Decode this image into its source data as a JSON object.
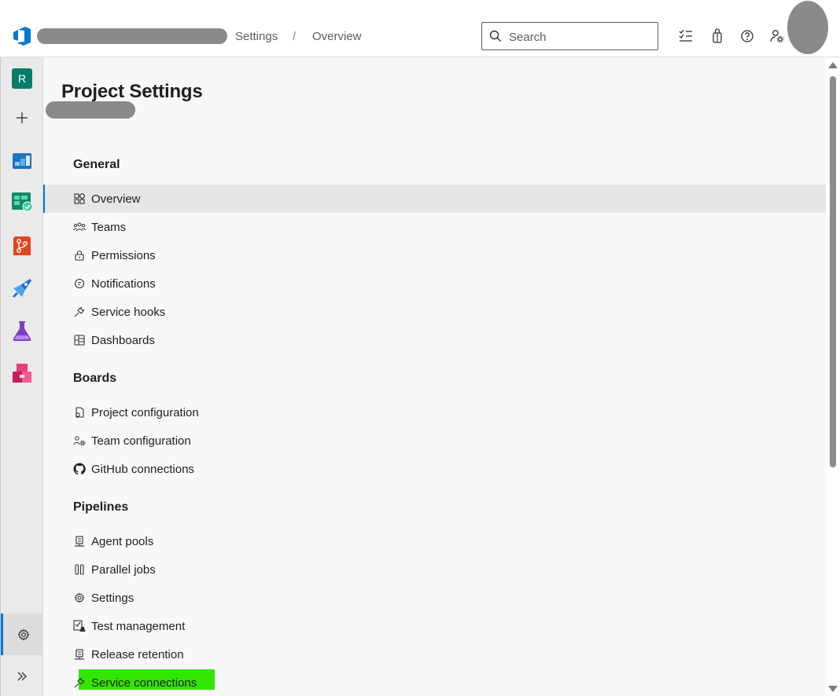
{
  "header": {
    "breadcrumb": [
      "Settings",
      "Overview"
    ],
    "separator": "/",
    "search_placeholder": "Search"
  },
  "rail": {
    "project_initial": "R"
  },
  "page": {
    "title": "Project Settings"
  },
  "sections": [
    {
      "title": "General",
      "items": [
        {
          "label": "Overview",
          "icon": "overview-icon",
          "selected": true
        },
        {
          "label": "Teams",
          "icon": "teams-icon"
        },
        {
          "label": "Permissions",
          "icon": "lock-icon"
        },
        {
          "label": "Notifications",
          "icon": "notification-icon"
        },
        {
          "label": "Service hooks",
          "icon": "plug-icon"
        },
        {
          "label": "Dashboards",
          "icon": "dashboard-icon"
        }
      ]
    },
    {
      "title": "Boards",
      "items": [
        {
          "label": "Project configuration",
          "icon": "config-icon"
        },
        {
          "label": "Team configuration",
          "icon": "team-config-icon"
        },
        {
          "label": "GitHub connections",
          "icon": "github-icon"
        }
      ]
    },
    {
      "title": "Pipelines",
      "items": [
        {
          "label": "Agent pools",
          "icon": "agent-icon"
        },
        {
          "label": "Parallel jobs",
          "icon": "parallel-icon"
        },
        {
          "label": "Settings",
          "icon": "gear-icon"
        },
        {
          "label": "Test management",
          "icon": "test-icon"
        },
        {
          "label": "Release retention",
          "icon": "agent-icon"
        },
        {
          "label": "Service connections",
          "icon": "plug-icon",
          "highlighted": true
        }
      ]
    }
  ],
  "colors": {
    "accent": "#0078d4",
    "highlight": "#33e600",
    "project_badge": "#0a7d6a"
  }
}
